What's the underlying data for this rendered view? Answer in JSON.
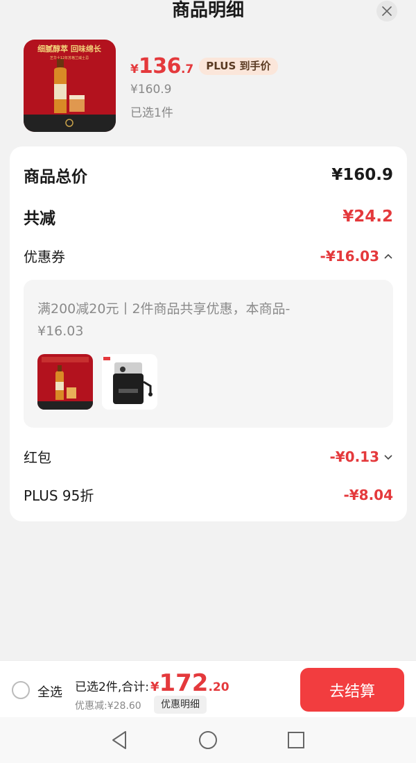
{
  "header": {
    "title": "商品明细"
  },
  "product": {
    "price_symbol": "¥",
    "price_integer": "136",
    "price_decimal": ".7",
    "plus_badge": "PLUS 到手价",
    "original_price": "¥160.9",
    "selected_count": "已选1件",
    "image_text": "细腻醇萃 回味绵长",
    "image_subtext": "芝华士12年苏格兰威士忌"
  },
  "summary": {
    "total_label": "商品总价",
    "total_value": "¥160.9",
    "reduction_label": "共减",
    "reduction_value": "¥24.2",
    "coupon_label": "优惠券",
    "coupon_value": "-¥16.03",
    "coupon_detail": "满200减20元丨2件商品共享优惠，本商品-¥16.03",
    "redpacket_label": "红包",
    "redpacket_value": "-¥0.13",
    "plus_label": "PLUS 95折",
    "plus_value": "-¥8.04"
  },
  "bottom": {
    "select_all": "全选",
    "total_prefix": "已选2件,合计:",
    "total_symbol": "¥",
    "total_integer": "172",
    "total_decimal": ".20",
    "discount": "优惠减:¥28.60",
    "detail_button": "优惠明细",
    "checkout_button": "去结算"
  },
  "icons": {
    "close": "close-icon",
    "chevron_up": "chevron-up-icon",
    "chevron_down": "chevron-down-icon",
    "nav_back": "triangle-back-icon",
    "nav_home": "circle-home-icon",
    "nav_recent": "square-recent-icon"
  },
  "colors": {
    "accent_red": "#e4393c",
    "checkout_red": "#f23d3f",
    "whisky_red": "#b3121e"
  }
}
